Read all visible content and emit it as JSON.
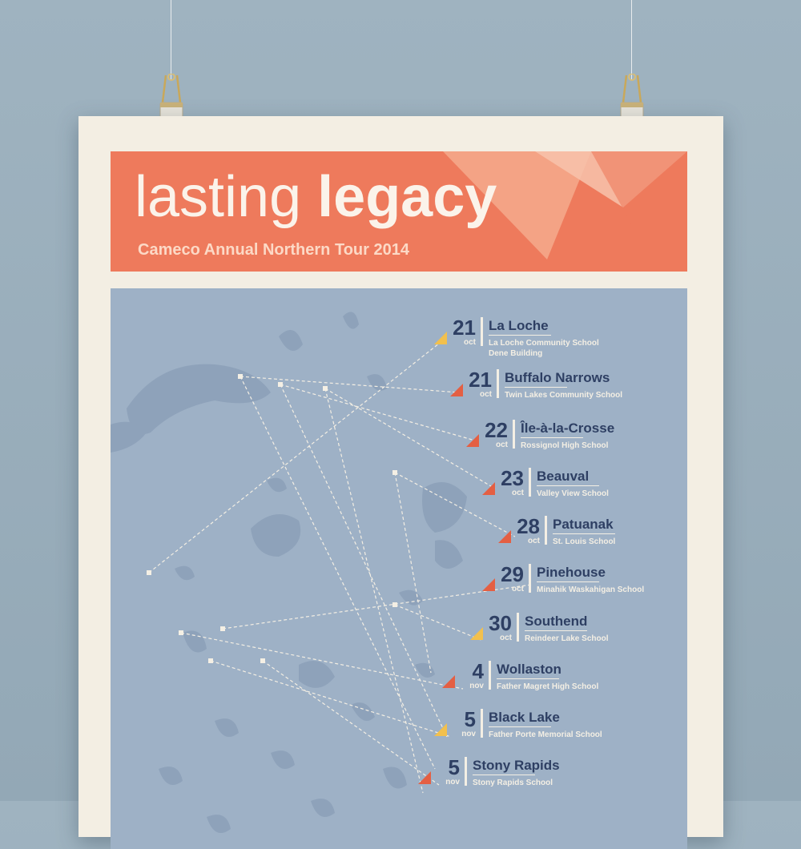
{
  "poster": {
    "title_light": "lasting",
    "title_bold": "legacy",
    "subtitle": "Cameco Annual Northern Tour 2014"
  },
  "colors": {
    "background": "#9fb3c0",
    "paper": "#f3eee3",
    "banner": "#ee7a5c",
    "map": "#9eb1c6",
    "lake": "#8ea2ba",
    "text_dark": "#2e3f63",
    "marker_red": "#e45f43",
    "marker_yellow": "#f2c04d"
  },
  "stops": [
    {
      "day": "21",
      "month": "oct",
      "town": "La Loche",
      "venues": [
        "La Loche Community School",
        "Dene Building"
      ],
      "marker": "yellow"
    },
    {
      "day": "21",
      "month": "oct",
      "town": "Buffalo Narrows",
      "venues": [
        "Twin Lakes Community School"
      ],
      "marker": "red"
    },
    {
      "day": "22",
      "month": "oct",
      "town": "Île-à-la-Crosse",
      "venues": [
        "Rossignol High School"
      ],
      "marker": "red"
    },
    {
      "day": "23",
      "month": "oct",
      "town": "Beauval",
      "venues": [
        "Valley View School"
      ],
      "marker": "red"
    },
    {
      "day": "28",
      "month": "oct",
      "town": "Patuanak",
      "venues": [
        "St. Louis School"
      ],
      "marker": "red"
    },
    {
      "day": "29",
      "month": "oct",
      "town": "Pinehouse",
      "venues": [
        "Minahik Waskahigan School"
      ],
      "marker": "red"
    },
    {
      "day": "30",
      "month": "oct",
      "town": "Southend",
      "venues": [
        "Reindeer Lake School"
      ],
      "marker": "yellow"
    },
    {
      "day": "4",
      "month": "nov",
      "town": "Wollaston",
      "venues": [
        "Father Magret High School"
      ],
      "marker": "red"
    },
    {
      "day": "5",
      "month": "nov",
      "town": "Black Lake",
      "venues": [
        "Father Porte Memorial School"
      ],
      "marker": "yellow"
    },
    {
      "day": "5",
      "month": "nov",
      "town": "Stony Rapids",
      "venues": [
        "Stony Rapids School"
      ],
      "marker": "red"
    }
  ]
}
